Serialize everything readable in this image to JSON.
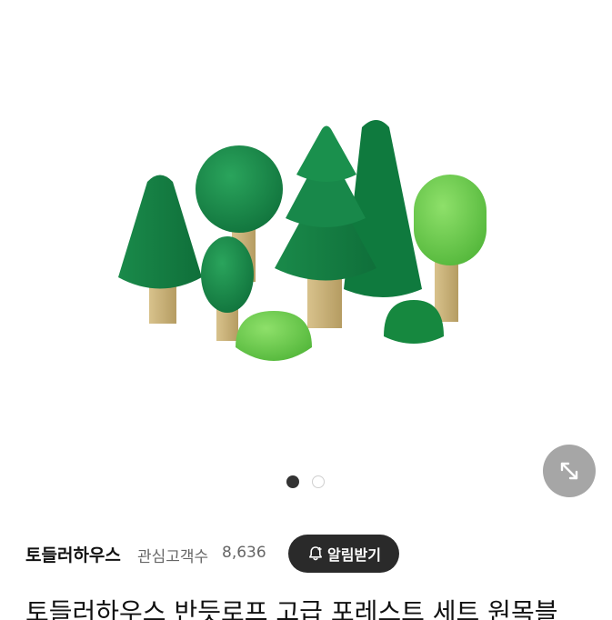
{
  "store": {
    "name": "토들러하우스",
    "interest_label": "관심고객수",
    "interest_count": "8,636",
    "alert_button_label": "알림받기"
  },
  "gallery": {
    "current_slide": 1,
    "total_slides": 2,
    "expand_icon": "expand-arrows-icon"
  },
  "product": {
    "title": "토들러하우스 반듯로프 고급 포레스트 세트 원목블"
  },
  "colors": {
    "dark_green": "#1e8f4e",
    "light_green": "#6fd24f",
    "wood": "#c9b27c",
    "button_dark": "#2a2a2a"
  }
}
